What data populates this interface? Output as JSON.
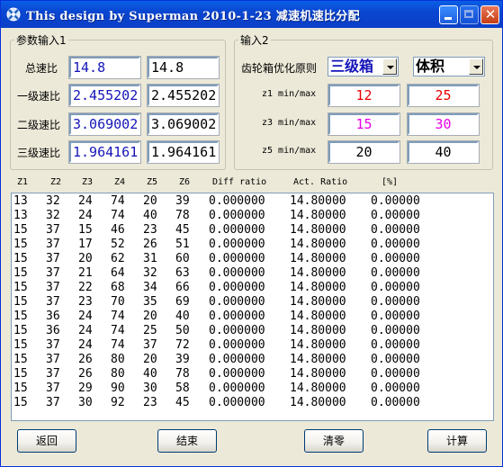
{
  "window": {
    "title": "This design by Superman  2010-1-23 减速机速比分配"
  },
  "group1": {
    "legend": "参数输入1",
    "rows": [
      {
        "label": "总速比",
        "input1": "14.8",
        "input2": "14.8"
      },
      {
        "label": "一级速比",
        "input1": "2.4552020",
        "input2": "2.4552020"
      },
      {
        "label": "二级速比",
        "input1": "3.0690025",
        "input2": "3.0690025"
      },
      {
        "label": "三级速比",
        "input1": "1.9641610",
        "input2": "1.9641610"
      }
    ]
  },
  "group2": {
    "legend": "输入2",
    "gear_label": "齿轮箱优化原则",
    "stage_select": "三级箱",
    "criterion_select": "体积",
    "rows": [
      {
        "label": "z1 min/max",
        "min": "12",
        "max": "25"
      },
      {
        "label": "z3 min/max",
        "min": "15",
        "max": "30"
      },
      {
        "label": "z5 min/max",
        "min": "20",
        "max": "40"
      }
    ]
  },
  "results": {
    "headers": [
      "Z1",
      "Z2",
      "Z3",
      "Z4",
      "Z5",
      "Z6",
      "Diff ratio",
      "Act. Ratio",
      "[%]"
    ],
    "rows": [
      [
        "13",
        "32",
        "24",
        "74",
        "20",
        "39",
        "0.000000",
        "14.80000",
        "0.00000"
      ],
      [
        "13",
        "32",
        "24",
        "74",
        "40",
        "78",
        "0.000000",
        "14.80000",
        "0.00000"
      ],
      [
        "15",
        "37",
        "15",
        "46",
        "23",
        "45",
        "0.000000",
        "14.80000",
        "0.00000"
      ],
      [
        "15",
        "37",
        "17",
        "52",
        "26",
        "51",
        "0.000000",
        "14.80000",
        "0.00000"
      ],
      [
        "15",
        "37",
        "20",
        "62",
        "31",
        "60",
        "0.000000",
        "14.80000",
        "0.00000"
      ],
      [
        "15",
        "37",
        "21",
        "64",
        "32",
        "63",
        "0.000000",
        "14.80000",
        "0.00000"
      ],
      [
        "15",
        "37",
        "22",
        "68",
        "34",
        "66",
        "0.000000",
        "14.80000",
        "0.00000"
      ],
      [
        "15",
        "37",
        "23",
        "70",
        "35",
        "69",
        "0.000000",
        "14.80000",
        "0.00000"
      ],
      [
        "15",
        "36",
        "24",
        "74",
        "20",
        "40",
        "0.000000",
        "14.80000",
        "0.00000"
      ],
      [
        "15",
        "36",
        "24",
        "74",
        "25",
        "50",
        "0.000000",
        "14.80000",
        "0.00000"
      ],
      [
        "15",
        "37",
        "24",
        "74",
        "37",
        "72",
        "0.000000",
        "14.80000",
        "0.00000"
      ],
      [
        "15",
        "37",
        "26",
        "80",
        "20",
        "39",
        "0.000000",
        "14.80000",
        "0.00000"
      ],
      [
        "15",
        "37",
        "26",
        "80",
        "40",
        "78",
        "0.000000",
        "14.80000",
        "0.00000"
      ],
      [
        "15",
        "37",
        "29",
        "90",
        "30",
        "58",
        "0.000000",
        "14.80000",
        "0.00000"
      ],
      [
        "15",
        "37",
        "30",
        "92",
        "23",
        "45",
        "0.000000",
        "14.80000",
        "0.00000"
      ]
    ]
  },
  "buttons": {
    "back": "返回",
    "end": "结束",
    "clear": "清零",
    "calc": "计算"
  },
  "colors": {
    "titlebar": "#0a46d1",
    "blue_text": "#1414b8",
    "red_text": "#e80000",
    "magenta_text": "#e800e8"
  }
}
